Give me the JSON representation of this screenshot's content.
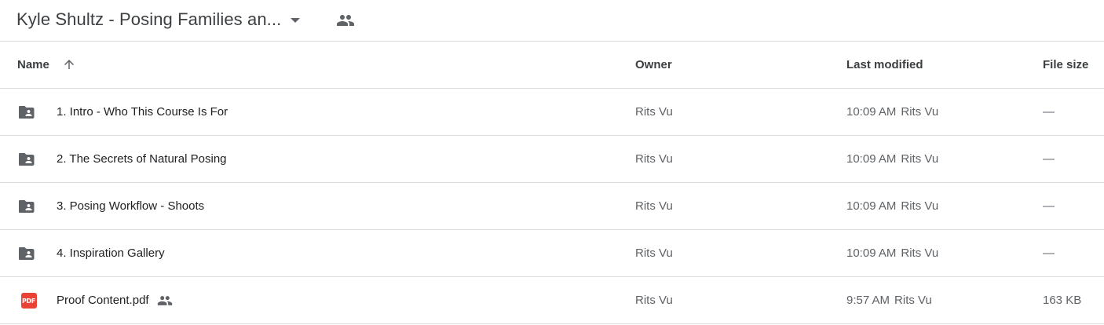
{
  "header": {
    "title": "Kyle Shultz - Posing Families an...",
    "dropdown_icon": "caret-down-icon",
    "shared_icon": "people-icon"
  },
  "columns": {
    "name": "Name",
    "sort_icon": "arrow-up-icon",
    "owner": "Owner",
    "last_modified": "Last modified",
    "file_size": "File size"
  },
  "rows": [
    {
      "icon": "shared-folder-icon",
      "name": "1. Intro - Who This Course Is For",
      "owner": "Rits Vu",
      "modified_time": "10:09 AM",
      "modified_by": "Rits Vu",
      "size": "—"
    },
    {
      "icon": "shared-folder-icon",
      "name": "2. The Secrets of Natural Posing",
      "owner": "Rits Vu",
      "modified_time": "10:09 AM",
      "modified_by": "Rits Vu",
      "size": "—"
    },
    {
      "icon": "shared-folder-icon",
      "name": "3. Posing Workflow - Shoots",
      "owner": "Rits Vu",
      "modified_time": "10:09 AM",
      "modified_by": "Rits Vu",
      "size": "—"
    },
    {
      "icon": "shared-folder-icon",
      "name": "4. Inspiration Gallery",
      "owner": "Rits Vu",
      "modified_time": "10:09 AM",
      "modified_by": "Rits Vu",
      "size": "—"
    },
    {
      "icon": "pdf-file-icon",
      "icon_text": "PDF",
      "name": "Proof Content.pdf",
      "shared": true,
      "owner": "Rits Vu",
      "modified_time": "9:57 AM",
      "modified_by": "Rits Vu",
      "size": "163 KB"
    }
  ],
  "colors": {
    "text_primary": "#202124",
    "text_secondary": "#5f6368",
    "divider": "#dadce0",
    "pdf_red": "#ea4335"
  }
}
